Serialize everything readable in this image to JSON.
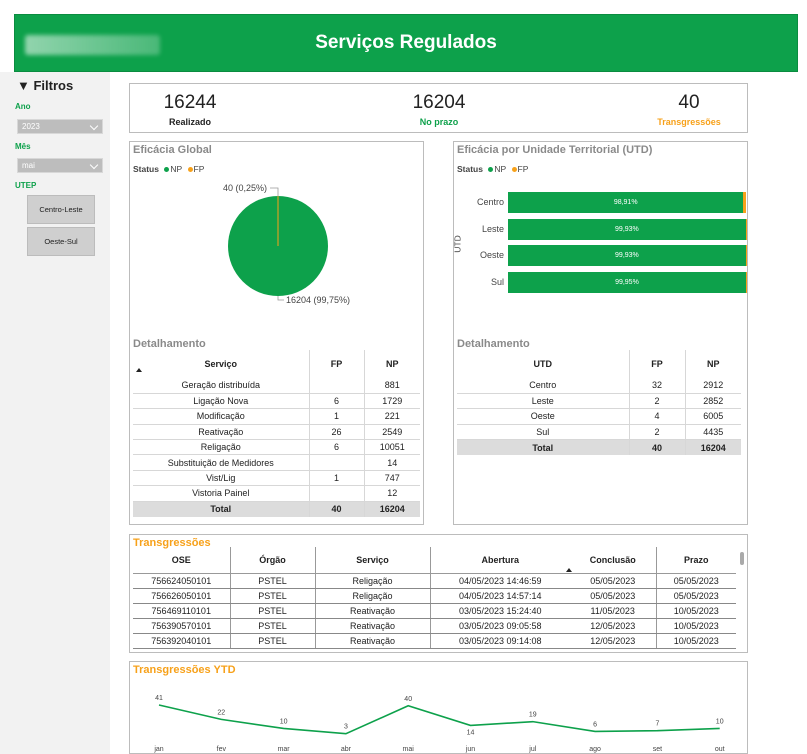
{
  "header": {
    "title": "Serviços Regulados",
    "logo_name": "company-logo"
  },
  "sidebar": {
    "title": "▼ Filtros",
    "ano_label": "Ano",
    "ano_value": "2023",
    "mes_label": "Mês",
    "mes_value": "mai",
    "utep_label": "UTEP",
    "utep_buttons": [
      "Centro-Leste",
      "Oeste-Sul"
    ]
  },
  "kpis": [
    {
      "value": "16244",
      "label": "Realizado",
      "color": "#222222"
    },
    {
      "value": "16204",
      "label": "No prazo",
      "color": "#0da14b"
    },
    {
      "value": "40",
      "label": "Transgressões",
      "color": "#f7a11a"
    }
  ],
  "colors": {
    "np": "#0da14b",
    "fp": "#f7a11a"
  },
  "global": {
    "title": "Eficácia Global",
    "status_label": "Status",
    "legend_np": "NP",
    "legend_fp": "FP",
    "pie_fp_label": "40 (0,25%)",
    "pie_np_label": "16204 (99,75%)"
  },
  "utd": {
    "title": "Eficácia por Unidade Territorial (UTD)",
    "status_label": "Status",
    "legend_np": "NP",
    "legend_fp": "FP",
    "axis_label": "UTD"
  },
  "chart_data": [
    {
      "type": "pie",
      "title": "Eficácia Global",
      "categories": [
        "NP",
        "FP"
      ],
      "values": [
        16204,
        40
      ],
      "labels": [
        "16204 (99,75%)",
        "40 (0,25%)"
      ]
    },
    {
      "type": "bar",
      "orientation": "horizontal",
      "stacked": true,
      "title": "Eficácia por Unidade Territorial (UTD)",
      "ylabel": "UTD",
      "categories": [
        "Centro",
        "Leste",
        "Oeste",
        "Sul"
      ],
      "series": [
        {
          "name": "NP",
          "values": [
            98.91,
            99.93,
            99.93,
            99.95
          ],
          "labels": [
            "98,91%",
            "99,93%",
            "99,93%",
            "99,95%"
          ]
        },
        {
          "name": "FP",
          "values": [
            1.09,
            0.07,
            0.07,
            0.05
          ]
        }
      ]
    },
    {
      "type": "line",
      "title": "Transgressões YTD",
      "x": [
        "jan",
        "fev",
        "mar",
        "abr",
        "mai",
        "jun",
        "jul",
        "ago",
        "set",
        "out"
      ],
      "values": [
        41,
        22,
        10,
        3,
        40,
        14,
        19,
        6,
        7,
        10
      ],
      "ylim": [
        0,
        45
      ]
    }
  ],
  "det_servico": {
    "title": "Detalhamento",
    "headers": [
      "Serviço",
      "FP",
      "NP"
    ],
    "rows": [
      [
        "Geração distribuída",
        "",
        "881"
      ],
      [
        "Ligação Nova",
        "6",
        "1729"
      ],
      [
        "Modificação",
        "1",
        "221"
      ],
      [
        "Reativação",
        "26",
        "2549"
      ],
      [
        "Religação",
        "6",
        "10051"
      ],
      [
        "Substituição de Medidores",
        "",
        "14"
      ],
      [
        "Vist/Lig",
        "1",
        "747"
      ],
      [
        "Vistoria Painel",
        "",
        "12"
      ]
    ],
    "total": [
      "Total",
      "40",
      "16204"
    ]
  },
  "det_utd": {
    "title": "Detalhamento",
    "headers": [
      "UTD",
      "FP",
      "NP"
    ],
    "rows": [
      [
        "Centro",
        "32",
        "2912"
      ],
      [
        "Leste",
        "2",
        "2852"
      ],
      [
        "Oeste",
        "4",
        "6005"
      ],
      [
        "Sul",
        "2",
        "4435"
      ]
    ],
    "total": [
      "Total",
      "40",
      "16204"
    ]
  },
  "transgressoes": {
    "title": "Transgressões",
    "headers": [
      "OSE",
      "Órgão",
      "Serviço",
      "Abertura",
      "Conclusão",
      "Prazo"
    ],
    "rows": [
      [
        "756624050101",
        "PSTEL",
        "Religação",
        "04/05/2023 14:46:59",
        "05/05/2023",
        "05/05/2023"
      ],
      [
        "756626050101",
        "PSTEL",
        "Religação",
        "04/05/2023 14:57:14",
        "05/05/2023",
        "05/05/2023"
      ],
      [
        "756469110101",
        "PSTEL",
        "Reativação",
        "03/05/2023 15:24:40",
        "11/05/2023",
        "10/05/2023"
      ],
      [
        "756390570101",
        "PSTEL",
        "Reativação",
        "03/05/2023 09:05:58",
        "12/05/2023",
        "10/05/2023"
      ],
      [
        "756392040101",
        "PSTEL",
        "Reativação",
        "03/05/2023 09:14:08",
        "12/05/2023",
        "10/05/2023"
      ]
    ]
  },
  "ytd": {
    "title": "Transgressões YTD"
  }
}
